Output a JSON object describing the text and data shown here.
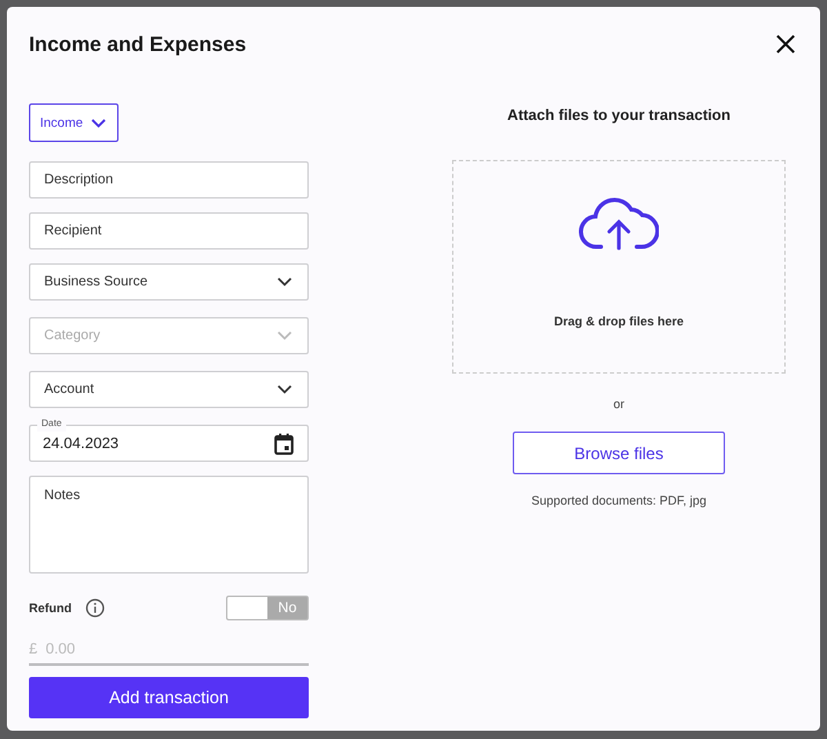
{
  "dialog": {
    "title": "Income and Expenses"
  },
  "type_select": {
    "value": "Income"
  },
  "fields": [
    {
      "kind": "text",
      "placeholder": "Description"
    },
    {
      "kind": "text",
      "placeholder": "Recipient"
    },
    {
      "kind": "select",
      "value": "Business Source",
      "disabled": false
    },
    {
      "kind": "select",
      "placeholder": "Category",
      "disabled": true
    },
    {
      "kind": "select",
      "value": "Account",
      "disabled": false
    },
    {
      "kind": "date",
      "label": "Date",
      "value": "24.04.2023"
    },
    {
      "kind": "textarea",
      "placeholder": "Notes"
    }
  ],
  "refund": {
    "label": "Refund",
    "toggle_text": "No",
    "on": false
  },
  "amount": {
    "currency": "£",
    "placeholder": "0.00"
  },
  "submit": "Add transaction",
  "attach": {
    "title": "Attach files to your transaction",
    "dropzone_text": "Drag & drop files here",
    "separator": "or",
    "browse_button": "Browse files",
    "supported": "Supported documents: PDF, jpg"
  }
}
